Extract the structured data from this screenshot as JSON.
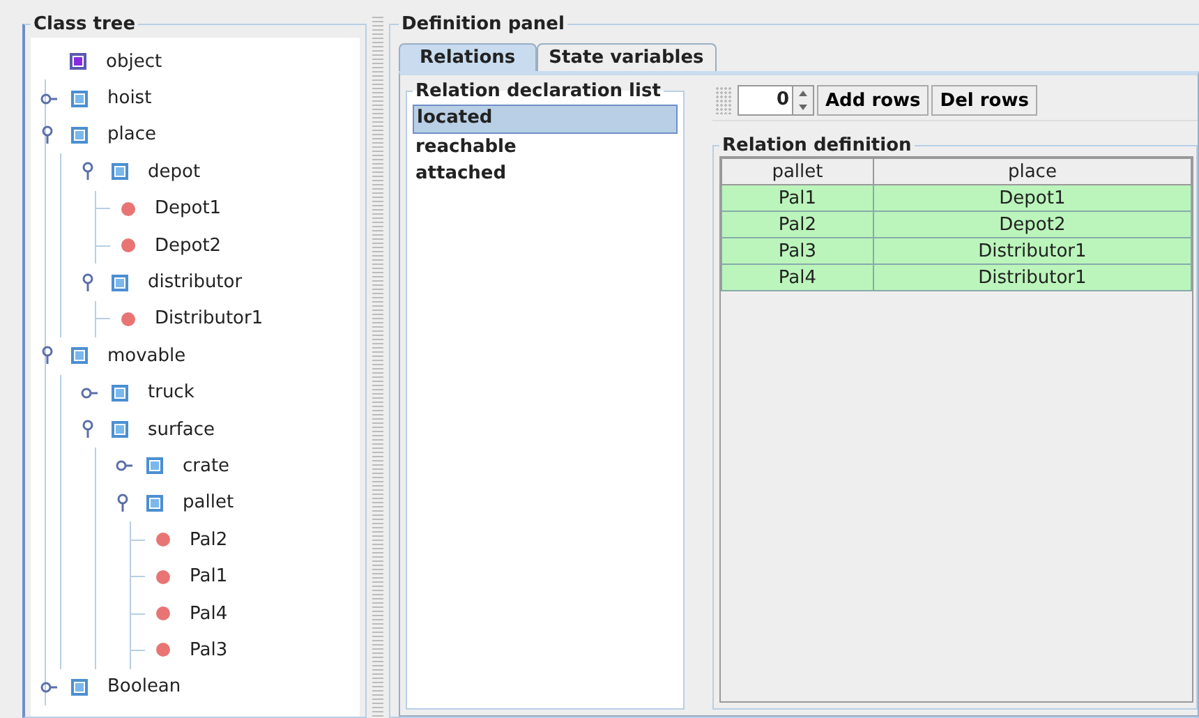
{
  "class_tree": {
    "title": "Class tree",
    "nodes": [
      {
        "label": "object",
        "kind": "root",
        "children": [
          {
            "label": "hoist",
            "kind": "class",
            "expanded": false
          },
          {
            "label": "place",
            "kind": "class",
            "expanded": true,
            "children": [
              {
                "label": "depot",
                "kind": "class",
                "expanded": true,
                "children": [
                  {
                    "label": "Depot1",
                    "kind": "instance"
                  },
                  {
                    "label": "Depot2",
                    "kind": "instance"
                  }
                ]
              },
              {
                "label": "distributor",
                "kind": "class",
                "expanded": true,
                "children": [
                  {
                    "label": "Distributor1",
                    "kind": "instance"
                  }
                ]
              }
            ]
          },
          {
            "label": "movable",
            "kind": "class",
            "expanded": true,
            "children": [
              {
                "label": "truck",
                "kind": "class",
                "expanded": false
              },
              {
                "label": "surface",
                "kind": "class",
                "expanded": true,
                "children": [
                  {
                    "label": "crate",
                    "kind": "class",
                    "expanded": false
                  },
                  {
                    "label": "pallet",
                    "kind": "class",
                    "expanded": true,
                    "children": [
                      {
                        "label": "Pal2",
                        "kind": "instance"
                      },
                      {
                        "label": "Pal1",
                        "kind": "instance"
                      },
                      {
                        "label": "Pal4",
                        "kind": "instance"
                      },
                      {
                        "label": "Pal3",
                        "kind": "instance"
                      }
                    ]
                  }
                ]
              }
            ]
          },
          {
            "label": "Boolean",
            "kind": "class",
            "expanded": false
          }
        ]
      }
    ]
  },
  "definition_panel": {
    "title": "Definition panel",
    "tabs": [
      {
        "label": "Relations",
        "selected": true
      },
      {
        "label": "State variables",
        "selected": false
      }
    ],
    "relation_list": {
      "title": "Relation declaration list",
      "items": [
        {
          "label": "located",
          "selected": true
        },
        {
          "label": "reachable",
          "selected": false
        },
        {
          "label": "attached",
          "selected": false
        }
      ]
    },
    "toolbar": {
      "row_count": "0",
      "buttons": [
        "Add rows",
        "Del rows"
      ]
    },
    "relation_definition": {
      "title": "Relation definition",
      "columns": [
        "pallet",
        "place"
      ],
      "rows": [
        [
          "Pal1",
          "Depot1"
        ],
        [
          "Pal2",
          "Depot2"
        ],
        [
          "Pal3",
          "Distributor1"
        ],
        [
          "Pal4",
          "Distributor1"
        ]
      ]
    }
  }
}
